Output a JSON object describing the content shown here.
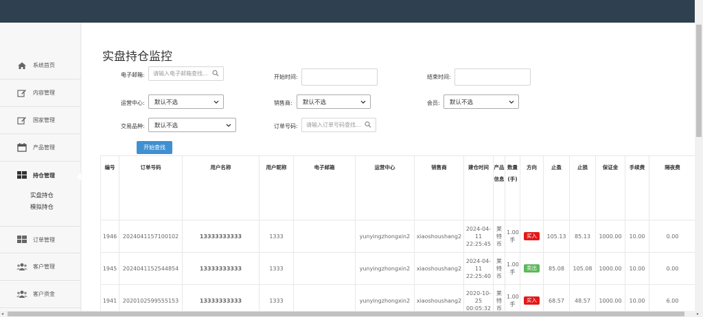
{
  "sidebar": {
    "items": [
      {
        "label": "系统首页",
        "icon": "home-icon"
      },
      {
        "label": "内容管理",
        "icon": "edit-icon"
      },
      {
        "label": "国家管理",
        "icon": "edit-icon"
      },
      {
        "label": "产品管理",
        "icon": "calendar-icon"
      },
      {
        "label": "持仓管理",
        "icon": "grid-icon"
      },
      {
        "label": "订单管理",
        "icon": "grid-icon"
      },
      {
        "label": "客户管理",
        "icon": "users-icon"
      },
      {
        "label": "客户资金",
        "icon": "users-icon"
      }
    ],
    "sub_items": [
      "实盘持仓",
      "模拟持仓"
    ]
  },
  "page": {
    "title": "实盘持仓监控"
  },
  "filters": {
    "email_label": "电子邮箱:",
    "email_placeholder": "请输入电子邮箱查找...",
    "start_label": "开始时间:",
    "end_label": "结束时间:",
    "ops_label": "运营中心:",
    "ops_value": "默认不选",
    "sales_label": "销售商:",
    "sales_value": "默认不选",
    "member_label": "会员:",
    "member_value": "默认不选",
    "product_label": "交易品种:",
    "product_value": "默认不选",
    "order_label": "订单号码:",
    "order_placeholder": "请输入订单号码查找...",
    "search_button": "开始查找"
  },
  "table": {
    "headers": [
      "编号",
      "订单号码",
      "用户名称",
      "用户昵称",
      "电子邮箱",
      "运营中心",
      "销售商",
      "建仓时间",
      "产品信息",
      "数量(手)",
      "方向",
      "止盈",
      "止损",
      "保证金",
      "手续费",
      "隔夜费"
    ],
    "rows": [
      {
        "id": "1946",
        "order": "2024041157100102",
        "user": "13333333333",
        "nick": "1333",
        "email": "",
        "ops": "yunyingzhongxin2",
        "sales": "xiaoshoushang2",
        "time": "2024-04-11 22:25:45",
        "product": "莱特币",
        "qty": "1.00 手",
        "dir": "买入",
        "dir_type": "buy",
        "tp": "105.13",
        "sl": "85.13",
        "margin": "1000.00",
        "fee": "10.00",
        "overnight": "0.00"
      },
      {
        "id": "1945",
        "order": "2024041152544854",
        "user": "13333333333",
        "nick": "1333",
        "email": "",
        "ops": "yunyingzhongxin2",
        "sales": "xiaoshoushang2",
        "time": "2024-04-11 22:25:40",
        "product": "莱特币",
        "qty": "1.00 手",
        "dir": "卖出",
        "dir_type": "sell",
        "tp": "85.08",
        "sl": "105.08",
        "margin": "1000.00",
        "fee": "10.00",
        "overnight": "0.00"
      },
      {
        "id": "1941",
        "order": "2020102599555153",
        "user": "13333333333",
        "nick": "1333",
        "email": "",
        "ops": "yunyingzhongxin2",
        "sales": "xiaoshoushang2",
        "time": "2020-10-25 00:05:32",
        "product": "莱特币",
        "qty": "1.00 手",
        "dir": "买入",
        "dir_type": "buy",
        "tp": "68.57",
        "sl": "48.57",
        "margin": "1000.00",
        "fee": "10.00",
        "overnight": "6.00"
      }
    ]
  },
  "colors": {
    "topbar": "#2f4050",
    "accent": "#3f8fd1",
    "buy": "#e21919",
    "sell": "#5cb85c",
    "link": "#1f6fb5"
  }
}
